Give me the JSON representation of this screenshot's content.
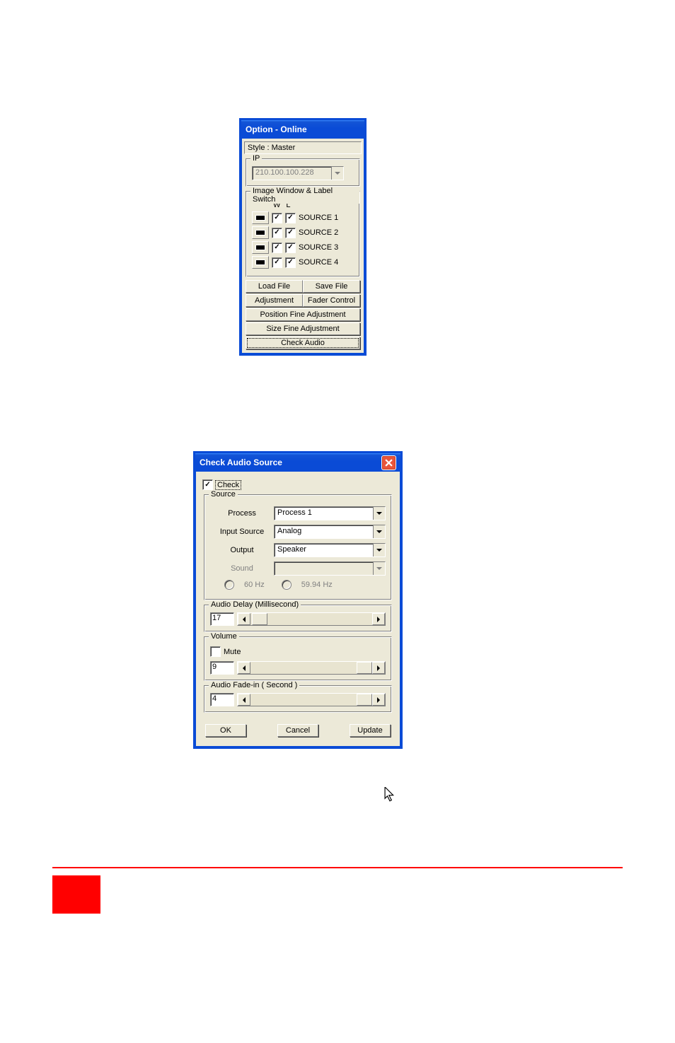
{
  "window1": {
    "title": "Option - Online",
    "style_label": "Style : Master",
    "ip_legend": "IP",
    "ip_value": "210.100.100.228",
    "switch_legend": "Image Window & Label Switch",
    "w_header": "W",
    "l_header": "L",
    "sources": [
      {
        "name": "SOURCE 1"
      },
      {
        "name": "SOURCE 2"
      },
      {
        "name": "SOURCE 3"
      },
      {
        "name": "SOURCE 4"
      }
    ],
    "buttons": {
      "load": "Load File",
      "save": "Save File",
      "adjustment": "Adjustment",
      "fader": "Fader Control",
      "pos_fine": "Position Fine Adjustment",
      "size_fine": "Size Fine Adjustment",
      "check_audio": "Check Audio"
    }
  },
  "window2": {
    "title": "Check Audio Source",
    "check_label": "Check",
    "source_legend": "Source",
    "process_label": "Process",
    "process_value": "Process 1",
    "input_label": "Input Source",
    "input_value": "Analog",
    "output_label": "Output",
    "output_value": "Speaker",
    "sound_label": "Sound",
    "sound_value": "",
    "hz60": "60 Hz",
    "hz5994": "59.94 Hz",
    "delay_legend": "Audio Delay (Millisecond)",
    "delay_value": "17",
    "volume_legend": "Volume",
    "mute_label": "Mute",
    "volume_value": "9",
    "fade_legend": "Audio Fade-in ( Second )",
    "fade_value": "4",
    "ok": "OK",
    "cancel": "Cancel",
    "update": "Update"
  }
}
